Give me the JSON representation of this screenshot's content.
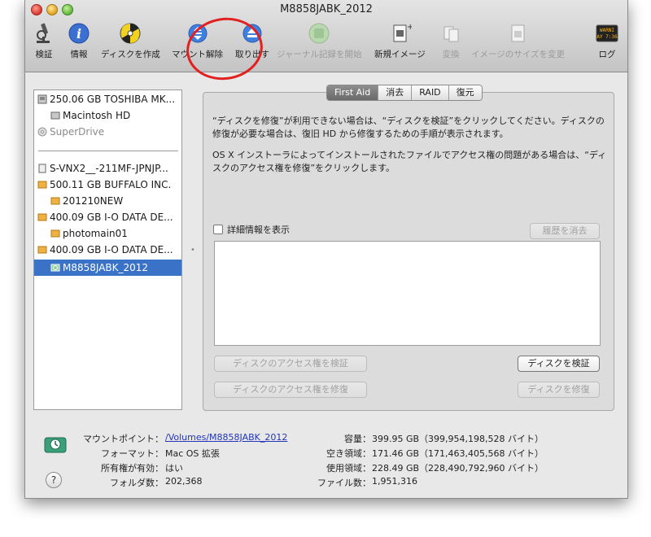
{
  "window": {
    "title": "M8858JABK_2012"
  },
  "toolbar": {
    "items": [
      {
        "label": "検証",
        "icon": "microscope-icon",
        "enabled": true
      },
      {
        "label": "情報",
        "icon": "info-icon",
        "enabled": true
      },
      {
        "label": "ディスクを作成",
        "icon": "burn-icon",
        "enabled": true
      },
      {
        "label": "マウント解除",
        "icon": "unmount-icon",
        "enabled": true
      },
      {
        "label": "取り出す",
        "icon": "eject-icon",
        "enabled": true
      },
      {
        "label": "ジャーナル記録を開始",
        "icon": "journal-icon",
        "enabled": false
      },
      {
        "label": "新規イメージ",
        "icon": "new-image-icon",
        "enabled": true
      },
      {
        "label": "変換",
        "icon": "convert-icon",
        "enabled": false
      },
      {
        "label": "イメージのサイズを変更",
        "icon": "resize-image-icon",
        "enabled": false
      },
      {
        "label": "ログ",
        "icon": "log-icon",
        "enabled": true
      }
    ],
    "log_icon_text": "WARNI\nAY 7:36"
  },
  "sidebar": {
    "items": [
      {
        "label": "250.06 GB TOSHIBA MK...",
        "icon": "internal-disk-icon"
      },
      {
        "label": "Macintosh HD",
        "icon": "volume-icon"
      },
      {
        "label": "SuperDrive",
        "icon": "optical-drive-icon"
      },
      {
        "label": "S-VNX2__-211MF-JPNJP...",
        "icon": "disk-icon"
      },
      {
        "label": "500.11 GB BUFFALO INC.",
        "icon": "external-disk-icon"
      },
      {
        "label": "201210NEW",
        "icon": "external-volume-icon"
      },
      {
        "label": "400.09 GB I-O DATA DE...",
        "icon": "external-disk-icon"
      },
      {
        "label": "photomain01",
        "icon": "external-volume-icon"
      },
      {
        "label": "400.09 GB I-O DATA DE...",
        "icon": "external-disk-icon"
      },
      {
        "label": "M8858JABK_2012",
        "icon": "time-machine-volume-icon"
      }
    ]
  },
  "tabs": [
    {
      "label": "First Aid",
      "active": true
    },
    {
      "label": "消去",
      "active": false
    },
    {
      "label": "RAID",
      "active": false
    },
    {
      "label": "復元",
      "active": false
    }
  ],
  "first_aid": {
    "para1_line1": "“ディスクを修復”が利用できない場合は、“ディスクを検証”をクリックしてください。ディスクの",
    "para1_line2": "修復が必要な場合は、復旧 HD から修復するための手順が表示されます。",
    "para2_line1": "OS X インストーラによってインストールされたファイルでアクセス権の問題がある場合は、“ディ",
    "para2_line2": "スクのアクセス権を修復”をクリックします。",
    "show_details": "詳細情報を表示",
    "clear_history": "履歴を消去",
    "verify_permissions": "ディスクのアクセス権を検証",
    "repair_permissions": "ディスクのアクセス権を修復",
    "verify_disk": "ディスクを検証",
    "repair_disk": "ディスクを修復"
  },
  "info": {
    "mount_point_label": "マウントポイント：",
    "mount_point_value": "/Volumes/M8858JABK_2012",
    "format_label": "フォーマット：",
    "format_value": "Mac OS 拡張",
    "owners_label": "所有権が有効：",
    "owners_value": "はい",
    "folders_label": "フォルダ数：",
    "folders_value": "202,368",
    "capacity_label": "容量：",
    "capacity_value": "399.95 GB（399,954,198,528 バイト）",
    "free_label": "空き領域：",
    "free_value": "171.46 GB（171,463,405,568 バイト）",
    "used_label": "使用領域：",
    "used_value": "228.49 GB（228,490,792,960 バイト）",
    "files_label": "ファイル数：",
    "files_value": "1,951,316"
  },
  "help_button": "?",
  "colors": {
    "selection": "#3a72c8",
    "annotation_circle": "#e22020",
    "link": "#2436b8"
  }
}
